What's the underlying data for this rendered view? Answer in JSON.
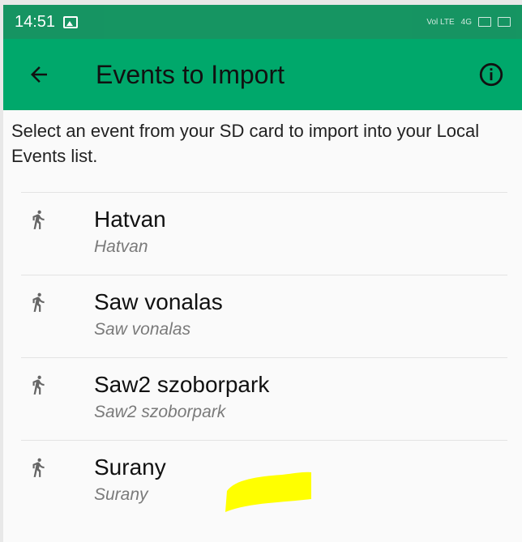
{
  "status_bar": {
    "time": "14:51",
    "icons": [
      "image-icon",
      "volte-icon",
      "signal-4g-icon",
      "signal-icon",
      "battery-icon"
    ],
    "labels": [
      "Vol LTE",
      "4G"
    ]
  },
  "app_bar": {
    "title": "Events to Import",
    "back_icon": "arrow-left-icon",
    "info_icon": "info-circle-icon",
    "color": "#00a86b"
  },
  "description": "Select an event from your SD card to import into your Local Events list.",
  "events": [
    {
      "title": "Hatvan",
      "subtitle": "Hatvan",
      "icon": "runner-icon"
    },
    {
      "title": "Saw vonalas",
      "subtitle": "Saw vonalas",
      "icon": "runner-icon"
    },
    {
      "title": "Saw2 szoborpark",
      "subtitle": "Saw2 szoborpark",
      "icon": "runner-icon"
    },
    {
      "title": "Surany",
      "subtitle": "Surany",
      "icon": "runner-icon"
    }
  ],
  "colors": {
    "status_bar": "#0a8f5a",
    "app_bar": "#00a86b",
    "background": "#fafafa",
    "highlight": "#ffff00"
  }
}
